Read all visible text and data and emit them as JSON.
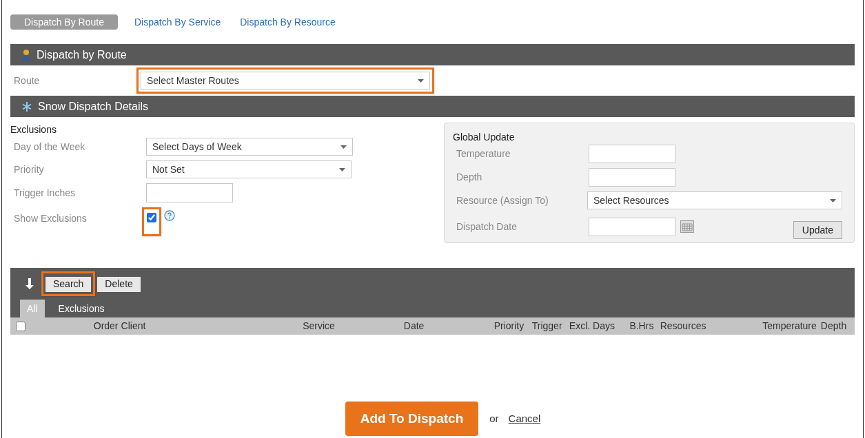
{
  "tabs": [
    {
      "label": "Dispatch By Route",
      "selected": true
    },
    {
      "label": "Dispatch By Service",
      "selected": false
    },
    {
      "label": "Dispatch By Resource",
      "selected": false
    }
  ],
  "route_section": {
    "title": "Dispatch by Route",
    "route": {
      "label": "Route",
      "placeholder": "Select Master Routes",
      "highlighted": true
    }
  },
  "details_section": {
    "title": "Snow Dispatch Details",
    "exclusions": {
      "title": "Exclusions",
      "day_of_week": {
        "label": "Day of the Week",
        "value": "Select Days of Week"
      },
      "priority": {
        "label": "Priority",
        "value": "Not Set"
      },
      "trigger_inches": {
        "label": "Trigger Inches"
      },
      "show_exclusions": {
        "label": "Show Exclusions",
        "checked": true,
        "highlighted": true
      }
    },
    "global_update": {
      "title": "Global Update",
      "temperature": {
        "label": "Temperature"
      },
      "depth": {
        "label": "Depth"
      },
      "resource": {
        "label": "Resource (Assign To)",
        "value": "Select Resources"
      },
      "dispatch_date": {
        "label": "Dispatch Date"
      },
      "update_button": "Update"
    }
  },
  "grid": {
    "buttons": [
      {
        "label": "Search",
        "highlighted": true
      },
      {
        "label": "Delete",
        "highlighted": false
      }
    ],
    "tabs": [
      {
        "label": "All",
        "selected": true
      },
      {
        "label": "Exclusions",
        "selected": false
      }
    ],
    "select_all_checked": false,
    "columns": [
      "Order",
      "Client",
      "Service",
      "Date",
      "Priority",
      "Trigger",
      "Excl. Days",
      "B.Hrs",
      "Resources",
      "Temperature",
      "Depth"
    ]
  },
  "footer": {
    "primary": "Add To Dispatch",
    "separator": "or",
    "cancel": "Cancel"
  }
}
